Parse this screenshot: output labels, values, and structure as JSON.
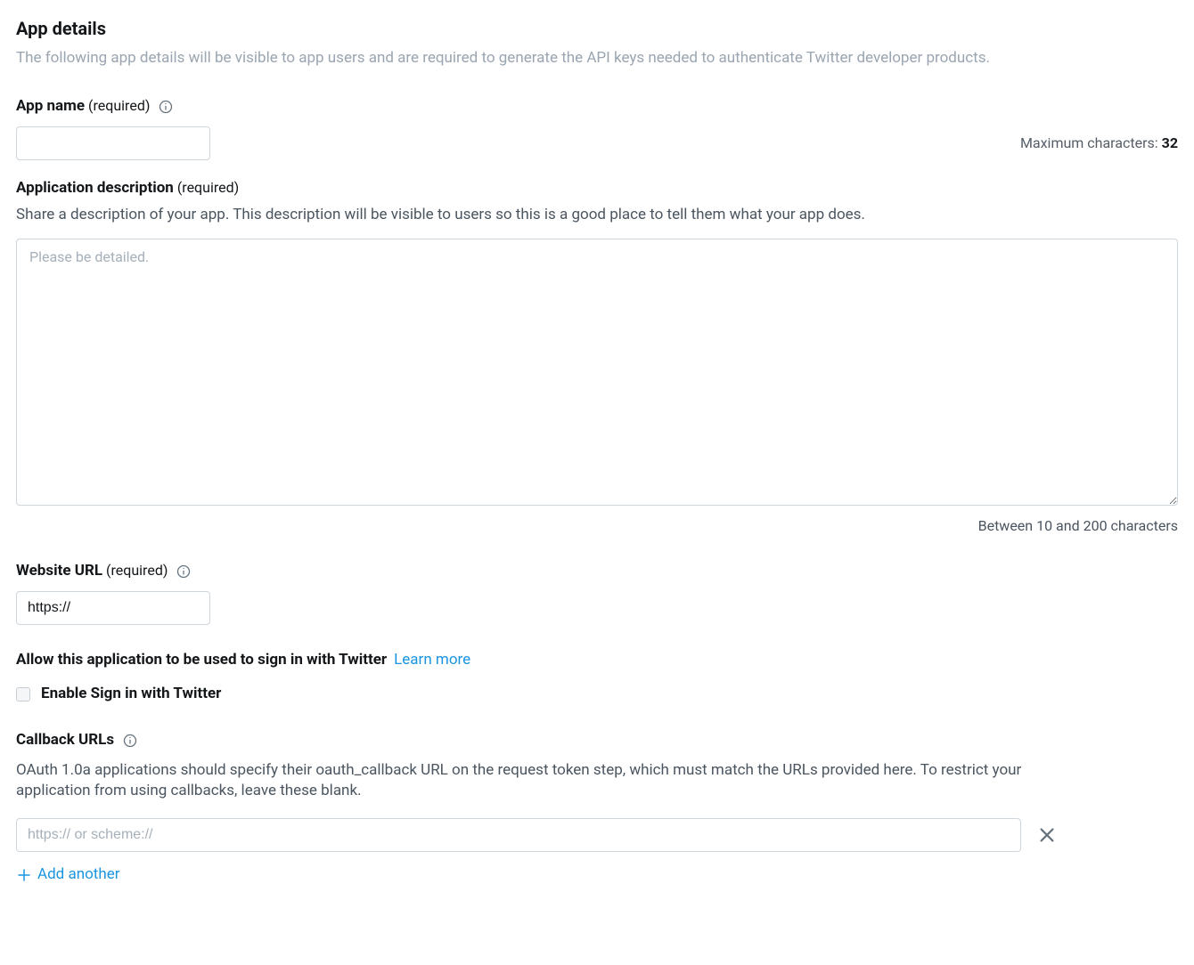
{
  "header": {
    "title": "App details",
    "description": "The following app details will be visible to app users and are required to generate the API keys needed to authenticate Twitter developer products."
  },
  "app_name": {
    "label": "App name",
    "required_text": "(required)",
    "value": "",
    "max_label": "Maximum characters:",
    "max_value": "32"
  },
  "app_description": {
    "label": "Application description",
    "required_text": "(required)",
    "help": "Share a description of your app. This description will be visible to users so this is a good place to tell them what your app does.",
    "placeholder": "Please be detailed.",
    "value": "",
    "limit_text": "Between 10 and 200 characters"
  },
  "website_url": {
    "label": "Website URL",
    "required_text": "(required)",
    "value": "https://"
  },
  "signin": {
    "heading": "Allow this application to be used to sign in with Twitter",
    "learn_more": "Learn more",
    "checkbox_label": "Enable Sign in with Twitter"
  },
  "callback": {
    "label": "Callback URLs",
    "description": "OAuth 1.0a applications should specify their oauth_callback URL on the request token step, which must match the URLs provided here. To restrict your application from using callbacks, leave these blank.",
    "placeholder": "https:// or scheme://",
    "value": "",
    "add_label": "Add another"
  }
}
